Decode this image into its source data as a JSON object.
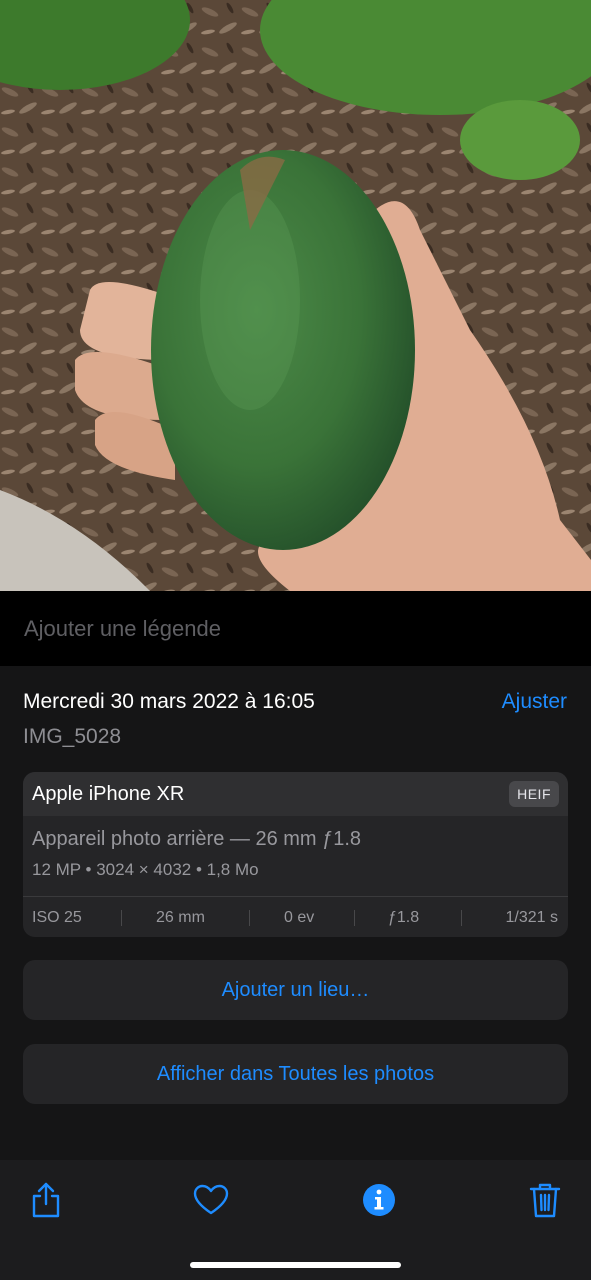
{
  "caption": {
    "placeholder": "Ajouter une légende"
  },
  "info": {
    "date": "Mercredi 30 mars 2022 à 16:05",
    "adjust_label": "Ajuster",
    "filename": "IMG_5028"
  },
  "metadata": {
    "device": "Apple iPhone XR",
    "format_badge": "HEIF",
    "lens": "Appareil photo arrière — 26 mm ƒ1.8",
    "specs": "12 MP  •  3024 × 4032  •  1,8 Mo",
    "exif": {
      "iso": "ISO 25",
      "focal": "26 mm",
      "ev": "0 ev",
      "aperture": "ƒ1.8",
      "shutter": "1/321 s"
    }
  },
  "actions": {
    "add_location": "Ajouter un lieu…",
    "show_in_all_photos": "Afficher dans Toutes les photos"
  },
  "toolbar": {
    "icons": [
      "share-icon",
      "heart-icon",
      "info-icon",
      "trash-icon"
    ],
    "accent_color": "#1e8cff"
  }
}
